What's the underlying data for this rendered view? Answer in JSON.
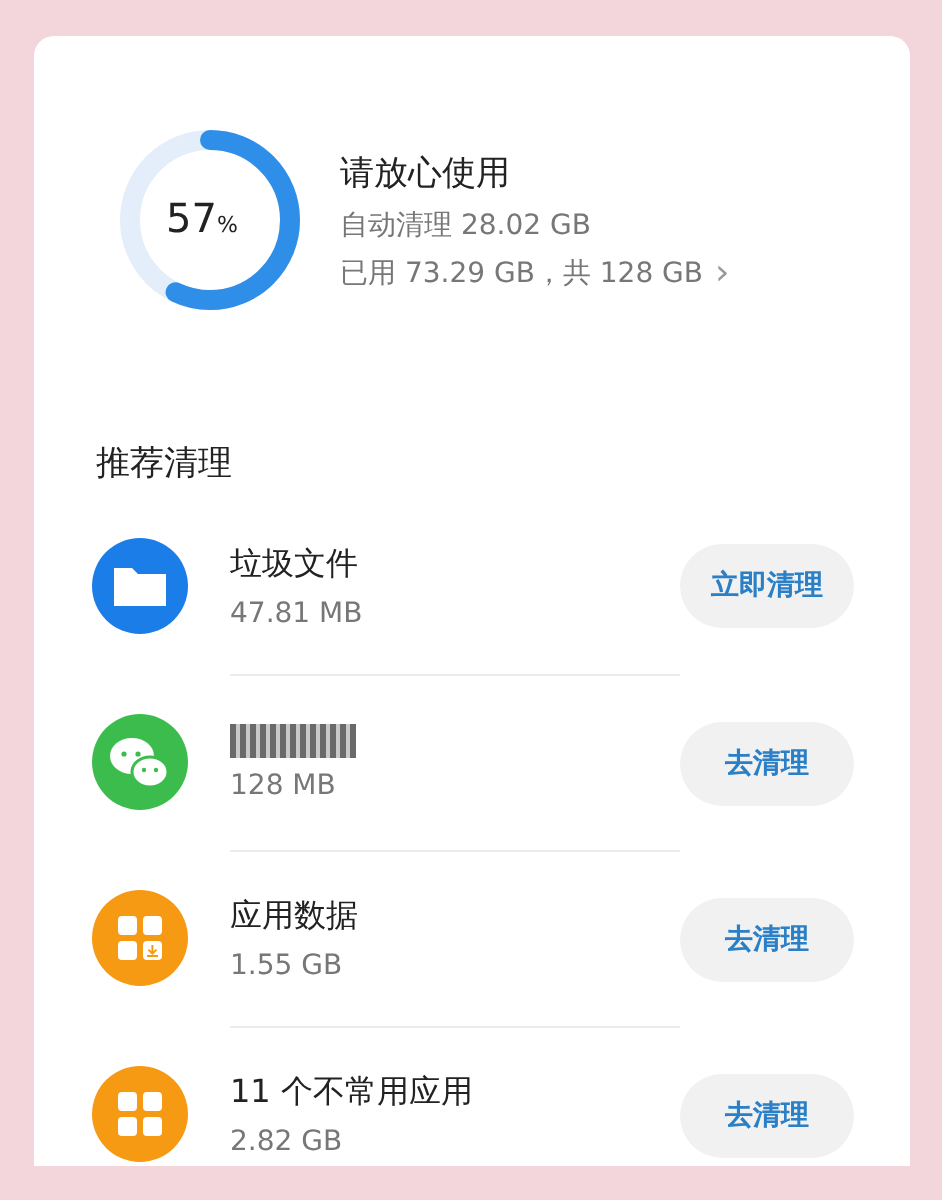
{
  "storage": {
    "level": 0.57,
    "percent": "57",
    "percent_sign": "%",
    "title": "请放心使用",
    "auto_clean": "自动清理 28.02 GB",
    "usage": "已用 73.29 GB，共 128 GB",
    "chevron": "›"
  },
  "section_title": "推荐清理",
  "items": [
    {
      "kind": "files",
      "title": "垃圾文件",
      "title_obscured": false,
      "size": "47.81 MB",
      "button": "立即清理"
    },
    {
      "kind": "chat",
      "title_obscured": true,
      "size": "128 MB",
      "button": "去清理"
    },
    {
      "kind": "app-data",
      "title": "应用数据",
      "title_obscured": false,
      "size": "1.55 GB",
      "button": "去清理"
    },
    {
      "kind": "apps",
      "title": "11 个不常用应用",
      "title_obscured": false,
      "size": "2.82 GB",
      "button": "去清理"
    }
  ]
}
